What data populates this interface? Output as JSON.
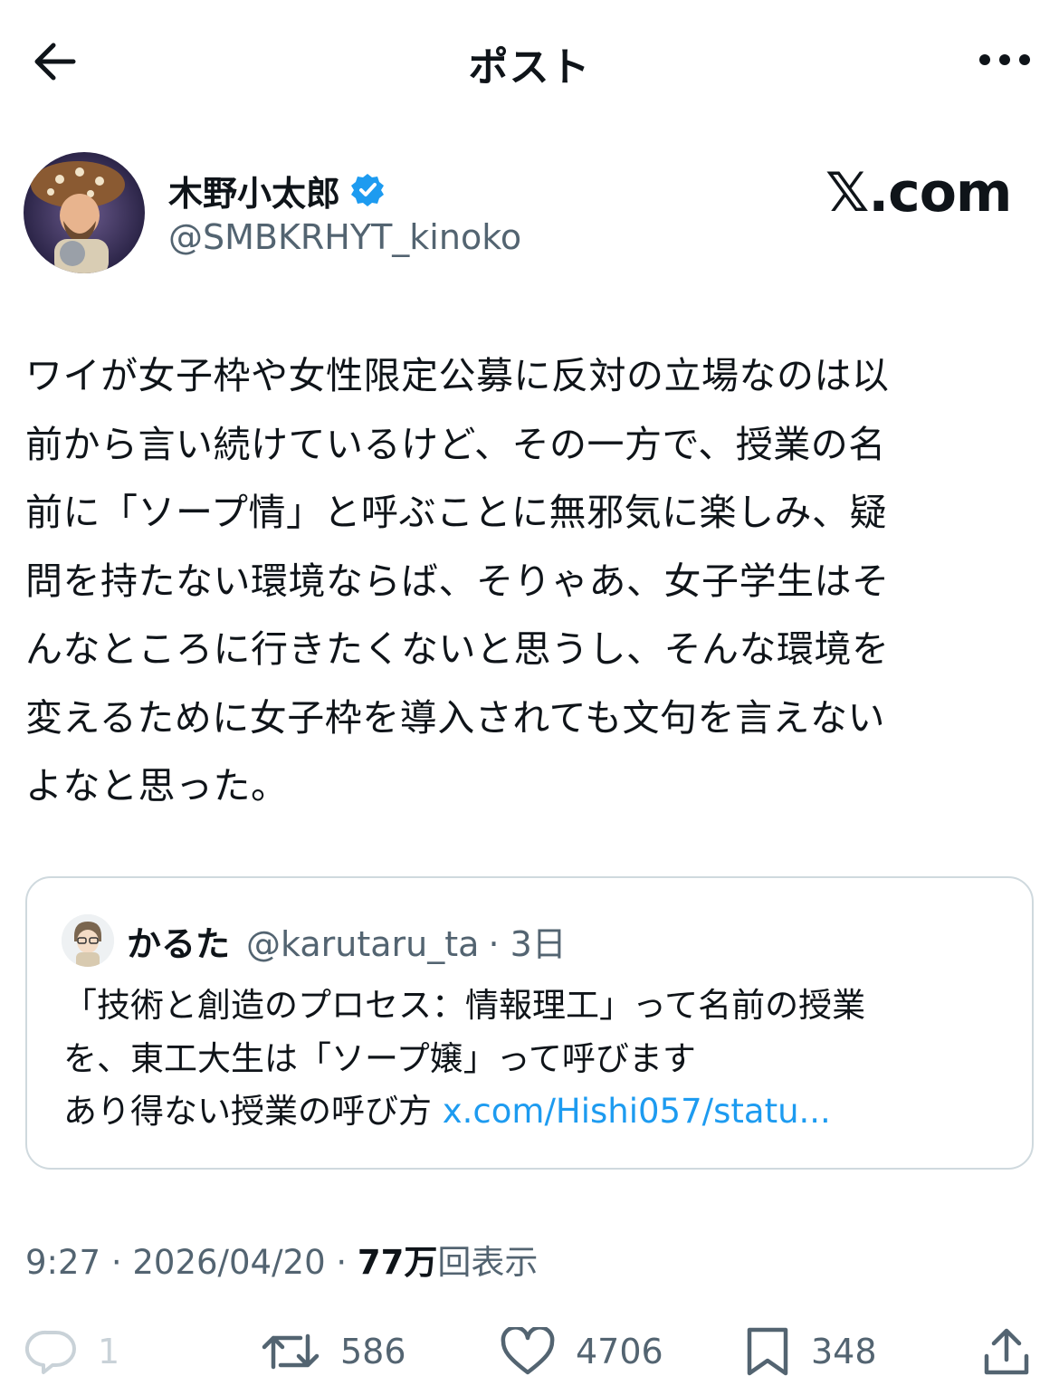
{
  "header": {
    "title": "ポスト"
  },
  "author": {
    "name": "木野小太郎",
    "handle": "@SMBKRHYT_kinoko",
    "verified_color": "#1d9bf0"
  },
  "watermark": "𝕏.com",
  "post": {
    "lines": [
      "ワイが女子枠や女性限定公募に反対の立場なのは以",
      "前から言い続けているけど、その一方で、授業の名",
      "前に「ソープ情」と呼ぶことに無邪気に楽しみ、疑",
      "問を持たない環境ならば、そりゃあ、女子学生はそ",
      "んなところに行きたくないと思うし、そんな環境を",
      "変えるために女子枠を導入されても文句を言えない",
      "よなと思った。"
    ]
  },
  "quote": {
    "name": "かるた",
    "handle": "@karutaru_ta",
    "time": "· 3日",
    "lines": [
      "「技術と創造のプロセス：情報理工」って名前の授業",
      "を、東工大生は「ソープ嬢」って呼びます",
      "あり得ない授業の呼び方 "
    ],
    "link": "x.com/Hishi057/statu..."
  },
  "meta": {
    "time": "9:27 · 2026/04/20 · ",
    "views_count": "77万",
    "views_label": "回表示"
  },
  "actions": {
    "reply": {
      "icon": "reply-icon",
      "count": "1"
    },
    "retweet": {
      "icon": "retweet-icon",
      "count": "586"
    },
    "like": {
      "icon": "heart-icon",
      "count": "4706"
    },
    "bookmark": {
      "icon": "bookmark-icon",
      "count": "348"
    },
    "share": {
      "icon": "share-icon"
    }
  },
  "colors": {
    "text": "#0f1419",
    "secondary": "#536471",
    "link": "#1d9bf0",
    "border": "#cfd9de"
  }
}
